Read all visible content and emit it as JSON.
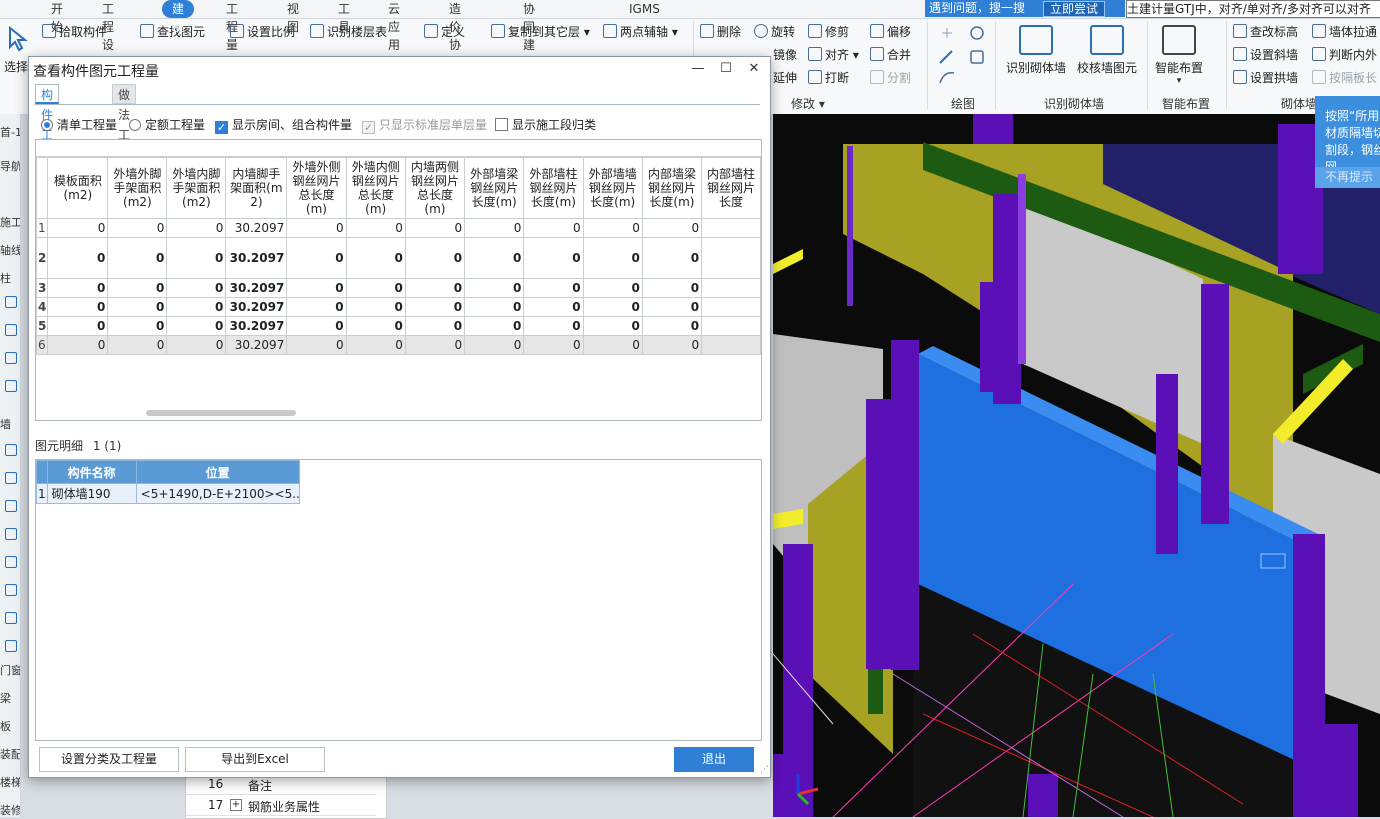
{
  "menu": {
    "items": [
      "开始",
      "工程设置",
      "建模",
      "工程量",
      "视图",
      "工具",
      "云应用",
      "造价协作",
      "协同建模(限免)",
      "IGMS"
    ],
    "active_index": 2
  },
  "topbar": {
    "tip_text": "遇到问题，搜一搜",
    "try_button": "立即尝试",
    "scroll_text": "土建计量GTJ中，对齐/单对齐/多对齐可以对齐",
    "accent_color": "#2f7fd6"
  },
  "ribbon": {
    "select_label": "选择",
    "col1": [
      "拾取构件",
      "查找图元"
    ],
    "col2": [
      "设置比例",
      "识别楼层表"
    ],
    "col3": [
      "定义",
      "复制到其它层",
      "两点辅轴"
    ],
    "modify": [
      "删除",
      "旋转",
      "修剪",
      "偏移",
      "镜像",
      "对齐",
      "合并",
      "延伸",
      "打断",
      "分割"
    ],
    "modify_group": "修改",
    "draw_group": "绘图",
    "recognize_wall": "识别砌体墙",
    "check_wall": "校核墙图元",
    "recognize_group": "识别砌体墙",
    "smart_layout": "智能布置",
    "smart_group": "智能布置",
    "wall_tools": [
      "查改标高",
      "墙体拉通",
      "设置斜墙",
      "判断内外",
      "设置拱墙",
      "按隔板长"
    ],
    "wall_group": "砌体墙"
  },
  "left_strip": {
    "items": [
      "首-1",
      "导航",
      "施工段",
      "轴线",
      "柱",
      "墙",
      "门窗洞",
      "梁",
      "板",
      "装配式",
      "楼梯",
      "装修"
    ]
  },
  "props_panel": {
    "rows": [
      {
        "num": "16",
        "text": "备注"
      },
      {
        "num": "17",
        "text": "钢筋业务属性"
      }
    ]
  },
  "hint_popup": {
    "text": "按照“所用材质隔墙切割段，钢丝网",
    "dismiss": "不再提示"
  },
  "dialog": {
    "title": "查看构件图元工程量",
    "tabs": [
      "构件工程量",
      "做法工程量"
    ],
    "options": [
      {
        "label": "清单工程量",
        "type": "radio",
        "checked": true,
        "disabled": false
      },
      {
        "label": "定额工程量",
        "type": "radio",
        "checked": false,
        "disabled": false
      },
      {
        "label": "显示房间、组合构件量",
        "type": "checkbox",
        "checked": true,
        "disabled": false
      },
      {
        "label": "只显示标准层单层量",
        "type": "checkbox",
        "checked": true,
        "disabled": true
      },
      {
        "label": "显示施工段归类",
        "type": "checkbox",
        "checked": false,
        "disabled": false
      }
    ],
    "table": {
      "columns": [
        "模板面积(m2)",
        "外墙外脚手架面积(m2)",
        "外墙内脚手架面积(m2)",
        "内墙脚手架面积(m2)",
        "外墙外侧钢丝网片总长度(m)",
        "外墙内侧钢丝网片总长度(m)",
        "内墙两侧钢丝网片总长度(m)",
        "外部墙梁钢丝网片长度(m)",
        "外部墙柱钢丝网片长度(m)",
        "外部墙墙钢丝网片长度(m)",
        "内部墙梁钢丝网片长度(m)",
        "内部墙柱钢丝网片长度"
      ],
      "rows": [
        {
          "n": "1",
          "style": "normal",
          "cells": [
            "0",
            "0",
            "0",
            "30.2097",
            "0",
            "0",
            "0",
            "0",
            "0",
            "0",
            "0",
            ""
          ]
        },
        {
          "n": "2",
          "style": "bold",
          "cells": [
            "0",
            "0",
            "0",
            "30.2097",
            "0",
            "0",
            "0",
            "0",
            "0",
            "0",
            "0",
            ""
          ]
        },
        {
          "n": "3",
          "style": "bold",
          "cells": [
            "0",
            "0",
            "0",
            "30.2097",
            "0",
            "0",
            "0",
            "0",
            "0",
            "0",
            "0",
            ""
          ]
        },
        {
          "n": "4",
          "style": "bold",
          "cells": [
            "0",
            "0",
            "0",
            "30.2097",
            "0",
            "0",
            "0",
            "0",
            "0",
            "0",
            "0",
            ""
          ]
        },
        {
          "n": "5",
          "style": "bold",
          "cells": [
            "0",
            "0",
            "0",
            "30.2097",
            "0",
            "0",
            "0",
            "0",
            "0",
            "0",
            "0",
            ""
          ]
        },
        {
          "n": "6",
          "style": "sel",
          "cells": [
            "0",
            "0",
            "0",
            "30.2097",
            "0",
            "0",
            "0",
            "0",
            "0",
            "0",
            "0",
            ""
          ]
        }
      ]
    },
    "detail": {
      "header": "图元明细",
      "count": "1 (1)",
      "columns": [
        "构件名称",
        "位置"
      ],
      "rows": [
        {
          "n": "1",
          "name": "砌体墙190",
          "pos": "<5+1490,D-E+2100><5..."
        }
      ]
    },
    "buttons": {
      "classify": "设置分类及工程量",
      "export": "导出到Excel",
      "exit": "退出"
    }
  }
}
